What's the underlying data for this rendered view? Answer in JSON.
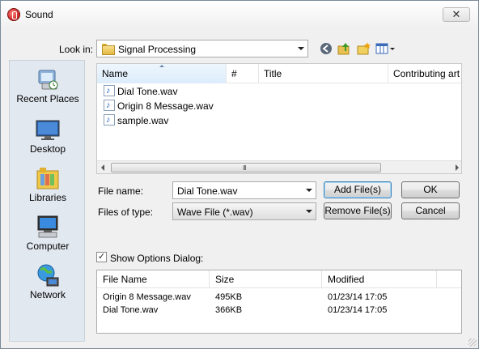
{
  "window": {
    "title": "Sound",
    "close_glyph": "✕"
  },
  "look_in": {
    "label": "Look in:",
    "value": "Signal Processing"
  },
  "toolbar": {
    "icons": [
      "back-icon",
      "up-folder-icon",
      "new-folder-icon",
      "view-menu-icon"
    ]
  },
  "places": [
    {
      "label": "Recent Places",
      "icon": "recent-places-icon"
    },
    {
      "label": "Desktop",
      "icon": "desktop-icon"
    },
    {
      "label": "Libraries",
      "icon": "libraries-icon"
    },
    {
      "label": "Computer",
      "icon": "computer-icon"
    },
    {
      "label": "Network",
      "icon": "network-icon"
    }
  ],
  "file_list": {
    "columns": [
      "Name",
      "#",
      "Title",
      "Contributing art"
    ],
    "files": [
      "Dial Tone.wav",
      "Origin 8 Message.wav",
      "sample.wav"
    ],
    "scroll_grip": "III"
  },
  "file_name": {
    "label": "File name:",
    "value": "Dial Tone.wav"
  },
  "file_type": {
    "label": "Files of type:",
    "value": "Wave File (*.wav)"
  },
  "buttons": {
    "add": "Add File(s)",
    "ok": "OK",
    "remove": "Remove File(s)",
    "cancel": "Cancel"
  },
  "options": {
    "label": "Show Options Dialog:",
    "checked": true,
    "check_glyph": "✓"
  },
  "selected_files": {
    "columns": [
      "File Name",
      "Size",
      "Modified"
    ],
    "rows": [
      {
        "name": "Origin 8 Message.wav",
        "size": "495KB",
        "modified": "01/23/14 17:05"
      },
      {
        "name": "Dial Tone.wav",
        "size": "366KB",
        "modified": "01/23/14 17:05"
      }
    ]
  },
  "colors": {
    "selection_blue": "#3c7fb1",
    "places_bg": "#e2e8f0"
  }
}
